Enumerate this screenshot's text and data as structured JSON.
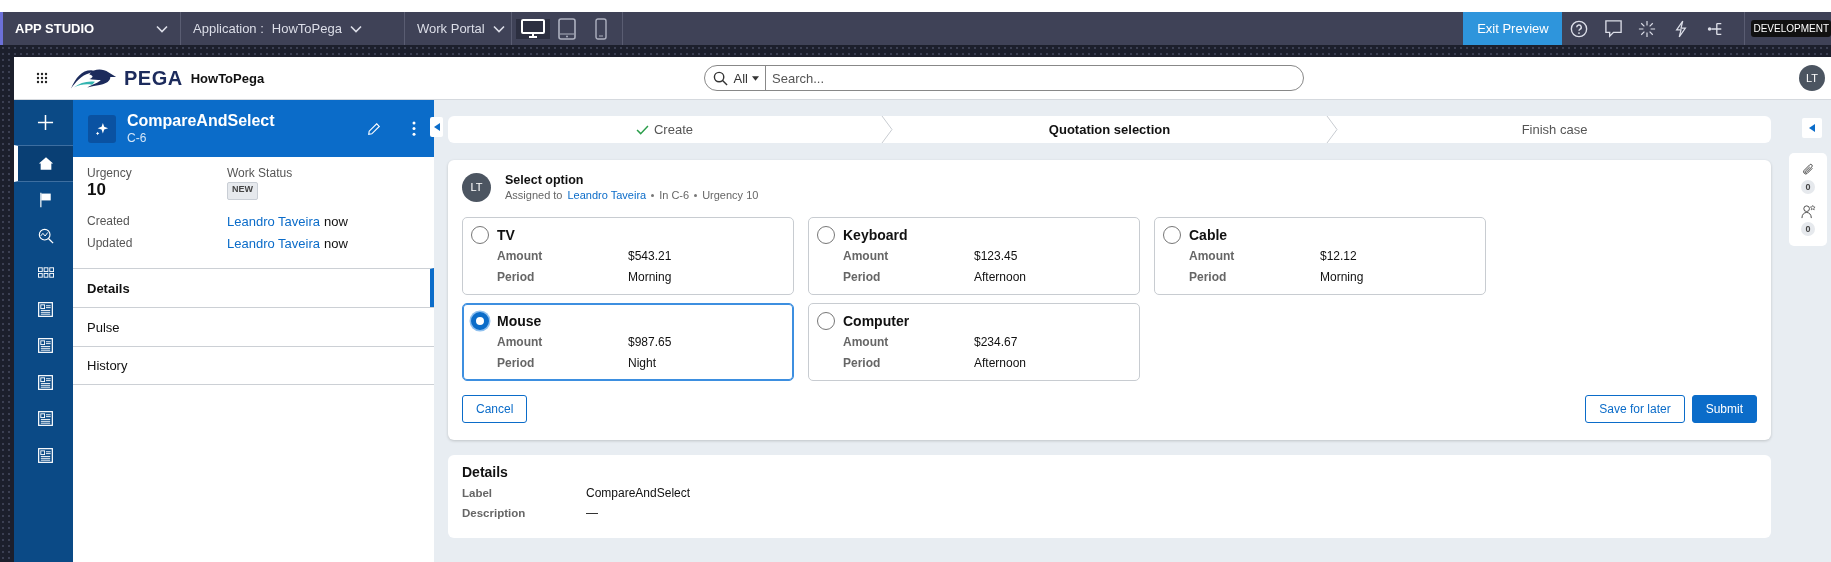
{
  "studio_bar": {
    "app_menu": "APP STUDIO",
    "application_label": "Application :",
    "application": "HowToPega",
    "portal": "Work Portal",
    "devices": [
      {
        "kind": "desktop",
        "selected": true
      },
      {
        "kind": "tablet",
        "selected": false
      },
      {
        "kind": "phone",
        "selected": false
      }
    ],
    "exit_preview": "Exit Preview",
    "environment": "DEVELOPMENT"
  },
  "header": {
    "brand": "PEGA",
    "app_name": "HowToPega",
    "search": {
      "filter": "All",
      "placeholder": "Search..."
    },
    "avatar": "LT"
  },
  "nav": [
    {
      "kind": "add",
      "selected": false
    },
    {
      "kind": "home",
      "selected": true
    },
    {
      "kind": "flag",
      "selected": false
    },
    {
      "kind": "explore",
      "selected": false
    },
    {
      "kind": "grid",
      "selected": false
    },
    {
      "kind": "document",
      "selected": false
    },
    {
      "kind": "document",
      "selected": false
    },
    {
      "kind": "document",
      "selected": false
    },
    {
      "kind": "document",
      "selected": false
    },
    {
      "kind": "document",
      "selected": false
    }
  ],
  "case": {
    "title": "CompareAndSelect",
    "id": "C-6",
    "urgency": {
      "label": "Urgency",
      "value": "10"
    },
    "work_status": {
      "label": "Work Status",
      "value": "NEW"
    },
    "history": [
      {
        "label": "Created",
        "user": "Leandro Taveira",
        "time": "now"
      },
      {
        "label": "Updated",
        "user": "Leandro Taveira",
        "time": "now"
      }
    ],
    "tabs": [
      {
        "label": "Details",
        "selected": true
      },
      {
        "label": "Pulse",
        "selected": false
      },
      {
        "label": "History",
        "selected": false
      }
    ]
  },
  "stages": [
    {
      "label": "Create",
      "completed": true,
      "current": false
    },
    {
      "label": "Quotation selection",
      "completed": false,
      "current": true
    },
    {
      "label": "Finish case",
      "completed": false,
      "current": false
    }
  ],
  "assignment": {
    "avatar": "LT",
    "title": "Select option",
    "assigned_label": "Assigned to",
    "assignee": "Leandro Taveira",
    "meta": [
      "In C-6",
      "Urgency 10"
    ],
    "options": [
      {
        "name": "TV",
        "selected": false,
        "fields": [
          {
            "label": "Amount",
            "value": "$543.21"
          },
          {
            "label": "Period",
            "value": "Morning"
          }
        ]
      },
      {
        "name": "Keyboard",
        "selected": false,
        "fields": [
          {
            "label": "Amount",
            "value": "$123.45"
          },
          {
            "label": "Period",
            "value": "Afternoon"
          }
        ]
      },
      {
        "name": "Cable",
        "selected": false,
        "fields": [
          {
            "label": "Amount",
            "value": "$12.12"
          },
          {
            "label": "Period",
            "value": "Morning"
          }
        ]
      },
      {
        "name": "Mouse",
        "selected": true,
        "fields": [
          {
            "label": "Amount",
            "value": "$987.65"
          },
          {
            "label": "Period",
            "value": "Night"
          }
        ]
      },
      {
        "name": "Computer",
        "selected": false,
        "fields": [
          {
            "label": "Amount",
            "value": "$234.67"
          },
          {
            "label": "Period",
            "value": "Afternoon"
          }
        ]
      }
    ],
    "actions": [
      {
        "label": "Cancel",
        "kind": "cancel"
      },
      {
        "label": "Save for later",
        "kind": "secondary"
      },
      {
        "label": "Submit",
        "kind": "primary"
      }
    ]
  },
  "details": {
    "title": "Details",
    "fields": [
      {
        "label": "Label",
        "value": "CompareAndSelect"
      },
      {
        "label": "Description",
        "value": "—"
      }
    ]
  },
  "utilities": [
    {
      "kind": "attachments",
      "count": "0"
    },
    {
      "kind": "followers",
      "count": "0"
    }
  ]
}
